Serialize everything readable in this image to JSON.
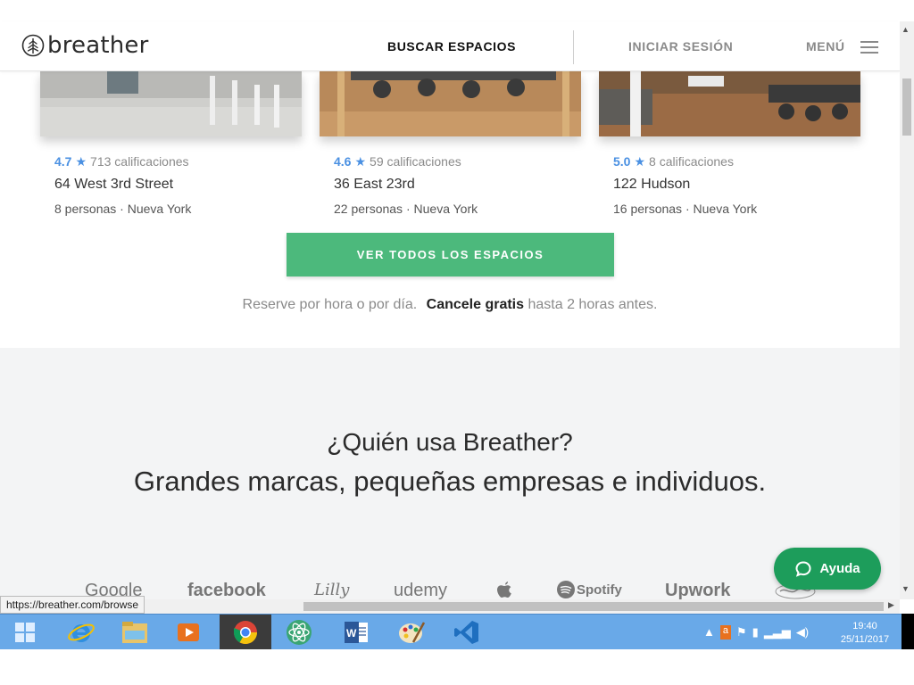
{
  "header": {
    "logo_text": "breather",
    "nav_search": "BUSCAR ESPACIOS",
    "nav_login": "INICIAR SESIÓN",
    "nav_menu": "MENÚ"
  },
  "spaces": [
    {
      "rating": "4.7",
      "ratings_text": "713 calificaciones",
      "name": "64 West 3rd Street",
      "people": "8 personas",
      "city": "Nueva York"
    },
    {
      "rating": "4.6",
      "ratings_text": "59 calificaciones",
      "name": "36 East 23rd",
      "people": "22 personas",
      "city": "Nueva York"
    },
    {
      "rating": "5.0",
      "ratings_text": "8 calificaciones",
      "name": "122 Hudson",
      "people": "16 personas",
      "city": "Nueva York"
    }
  ],
  "view_all_label": "VER TODOS LOS ESPACIOS",
  "reserve": {
    "prefix": "Reserve por hora o por día.",
    "bold": "Cancele gratis",
    "suffix": "hasta 2 horas antes."
  },
  "who": {
    "title": "¿Quién usa Breather?",
    "subtitle": "Grandes marcas, pequeñas empresas e individuos."
  },
  "brands": [
    "Google",
    "facebook",
    "Lilly",
    "udemy",
    "Spotify",
    "Upwork"
  ],
  "help_label": "Ayuda",
  "status_url": "https://breather.com/browse",
  "clock": {
    "time": "19:40",
    "date": "25/11/2017"
  },
  "colors": {
    "accent_green": "#4cb97c",
    "help_green": "#1d9d5b",
    "rating_blue": "#4a90e2",
    "taskbar": "#69a9e8"
  },
  "taskbar_icons": [
    "windows-start-icon",
    "internet-explorer-icon",
    "file-explorer-icon",
    "media-player-icon",
    "chrome-icon",
    "atom-icon",
    "word-icon",
    "paint-icon",
    "vscode-icon"
  ]
}
